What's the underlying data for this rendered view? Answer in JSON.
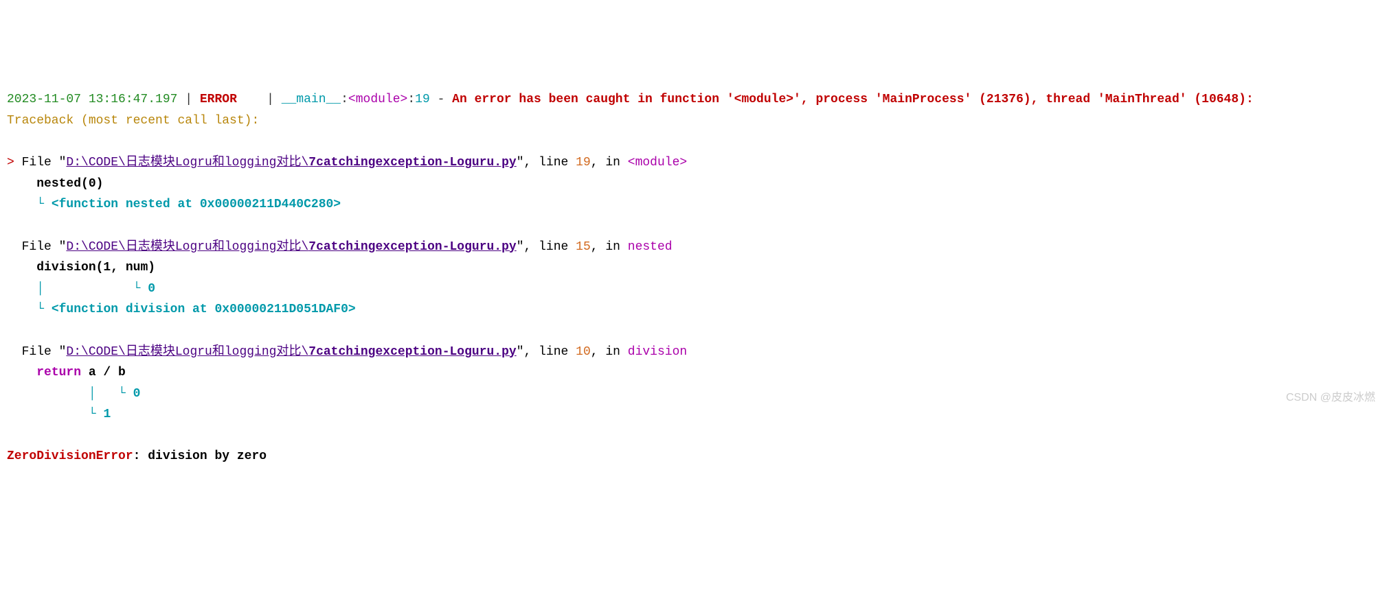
{
  "header": {
    "timestamp": "2023-11-07 13:16:47.197",
    "sep1": " | ",
    "level": "ERROR",
    "sep2": "    | ",
    "module": "__main__",
    "colon1": ":",
    "func": "<module>",
    "colon2": ":",
    "line": "19",
    "dash": " - ",
    "msg": "An error has been caught in function '<module>', process 'MainProcess' (21376), thread 'MainThread' (10648):"
  },
  "traceback_label": "Traceback (most recent call last):",
  "frames": [
    {
      "arrow": "> ",
      "file_label": "File \"",
      "path": "D:\\CODE\\日志模块Logru和logging对比\\",
      "filename": "7catchingexception-Loguru.py",
      "quote": "\", ",
      "line_label": "line ",
      "line_no": "19",
      "in_label": ", in ",
      "scope": "<module>",
      "code_indent": "    ",
      "code": "nested(0)",
      "tree1_indent": "    ",
      "tree1": "└ ",
      "var1": "<function nested at 0x00000211D440C280>"
    },
    {
      "arrow": "  ",
      "file_label": "File \"",
      "path": "D:\\CODE\\日志模块Logru和logging对比\\",
      "filename": "7catchingexception-Loguru.py",
      "quote": "\", ",
      "line_label": "line ",
      "line_no": "15",
      "in_label": ", in ",
      "scope": "nested",
      "code_indent": "    ",
      "code": "division(1, num)",
      "tree_a_indent": "    ",
      "tree_a": "│            └ ",
      "var_a": "0",
      "tree_b_indent": "    ",
      "tree_b": "└ ",
      "var_b": "<function division at 0x00000211D051DAF0>"
    },
    {
      "arrow": "  ",
      "file_label": "File \"",
      "path": "D:\\CODE\\日志模块Logru和logging对比\\",
      "filename": "7catchingexception-Loguru.py",
      "quote": "\", ",
      "line_label": "line ",
      "line_no": "10",
      "in_label": ", in ",
      "scope": "division",
      "code_indent": "    ",
      "keyword": "return",
      "code_rest": " a / b",
      "tree_a_indent": "           ",
      "tree_a": "│   └ ",
      "var_a": "0",
      "tree_b_indent": "           ",
      "tree_b": "└ ",
      "var_b": "1"
    }
  ],
  "exception": {
    "name": "ZeroDivisionError",
    "colon": ": ",
    "msg": "division by zero"
  },
  "watermark": "CSDN @皮皮冰燃"
}
